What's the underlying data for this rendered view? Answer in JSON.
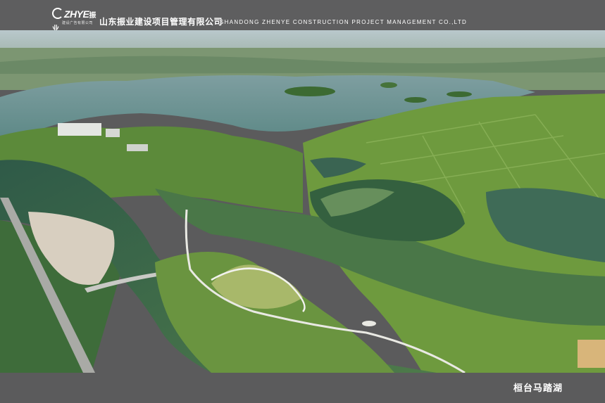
{
  "header": {
    "logo_text": "ZHYE",
    "logo_cn": "振业",
    "logo_sub": "建设广告有限公司",
    "company_cn": "山东振业建设项目管理有限公司",
    "company_en": "SHANDONG ZHENYE CONSTRUCTION PROJECT MANAGEMENT CO.,LTD"
  },
  "photo": {
    "subject": "aerial view of wetland park with lakes, islands, canals and roads"
  },
  "footer": {
    "caption": "桓台马踏湖"
  },
  "colors": {
    "banner": "#5e5e5f",
    "text": "#ffffff",
    "water": "#3f6a4f",
    "wetland": "#5f8f3a"
  }
}
